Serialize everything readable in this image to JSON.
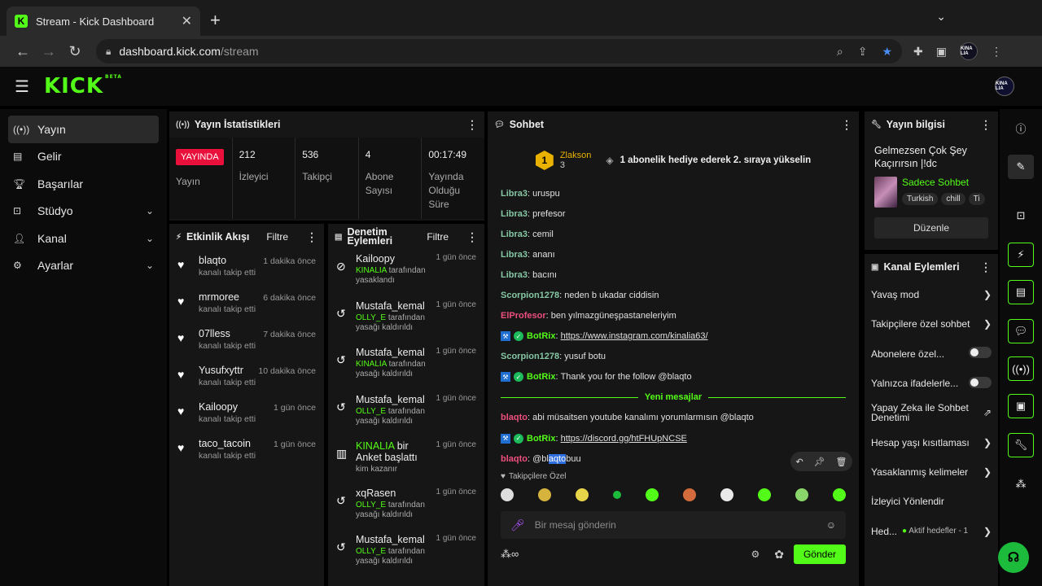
{
  "browser": {
    "tab_title": "Stream - Kick Dashboard",
    "tab_favicon": "K",
    "url_host": "dashboard.kick.com",
    "url_path": "/stream",
    "profile_badge": "KINA LIA"
  },
  "app": {
    "logo": "KICK",
    "logo_tag": "BETA",
    "avatar": "KINA LIA"
  },
  "sidebar": {
    "items": [
      {
        "label": "Yayın",
        "icon": "broadcast-icon"
      },
      {
        "label": "Gelir",
        "icon": "revenue-icon"
      },
      {
        "label": "Başarılar",
        "icon": "trophy-icon"
      },
      {
        "label": "Stüdyo",
        "icon": "studio-icon"
      },
      {
        "label": "Kanal",
        "icon": "channel-icon"
      },
      {
        "label": "Ayarlar",
        "icon": "gear-icon"
      }
    ]
  },
  "stats_panel": {
    "title": "Yayın İstatistikleri",
    "live_badge": "YAYINDA",
    "live_label": "Yayın",
    "viewers_value": "212",
    "viewers_label": "İzleyici",
    "followers_value": "536",
    "followers_label": "Takipçi",
    "subs_value": "4",
    "subs_label": "Abone Sayısı",
    "duration_value": "00:17:49",
    "duration_label": "Yayında Olduğu Süre"
  },
  "activity_panel": {
    "title": "Etkinlik Akışı",
    "filter": "Filtre",
    "rows": [
      {
        "name": "blaqto",
        "sub": "kanalı takip etti",
        "time": "1 dakika önce"
      },
      {
        "name": "mrmoree",
        "sub": "kanalı takip etti",
        "time": "6 dakika önce"
      },
      {
        "name": "07lless",
        "sub": "kanalı takip etti",
        "time": "7 dakika önce"
      },
      {
        "name": "Yusufxyttr",
        "sub": "kanalı takip etti",
        "time": "10 dakika önce"
      },
      {
        "name": "Kailoopy",
        "sub": "kanalı takip etti",
        "time": "1 gün önce"
      },
      {
        "name": "taco_tacoin",
        "sub": "kanalı takip etti",
        "time": "1 gün önce"
      }
    ]
  },
  "moderation_panel": {
    "title": "Denetim Eylemleri",
    "filter": "Filtre",
    "rows": [
      {
        "name": "Kailoopy",
        "by": "KINALIA",
        "sub": "tarafından yasaklandı",
        "time": "1 gün önce"
      },
      {
        "name": "Mustafa_kemal",
        "by": "OLLY_E",
        "sub": "tarafından yasağı kaldırıldı",
        "time": "1 gün önce"
      },
      {
        "name": "Mustafa_kemal",
        "by": "KINALIA",
        "sub": "tarafından yasağı kaldırıldı",
        "time": "1 gün önce"
      },
      {
        "name": "Mustafa_kemal",
        "by": "OLLY_E",
        "sub": "tarafından yasağı kaldırıldı",
        "time": "1 gün önce"
      },
      {
        "name": "bir Anket başlattı",
        "by": "KINALIA",
        "sub": "kim kazanır",
        "time": "1 gün önce"
      },
      {
        "name": "xqRasen",
        "by": "OLLY_E",
        "sub": "tarafından yasağı kaldırıldı",
        "time": "1 gün önce"
      },
      {
        "name": "Mustafa_kemal",
        "by": "OLLY_E",
        "sub": "tarafından yasağı kaldırıldı",
        "time": "1 gün önce"
      }
    ]
  },
  "chat": {
    "title": "Sohbet",
    "pinned_rank": "1",
    "pinned_name": "Zlakson",
    "pinned_count": "3",
    "pinned_message": "1 abonelik hediye ederek 2. sıraya yükselin",
    "messages": [
      {
        "user": "Libra3",
        "text": "uruspu",
        "color": "g"
      },
      {
        "user": "Libra3",
        "text": "prefesor",
        "color": "g"
      },
      {
        "user": "Libra3",
        "text": "cemil",
        "color": "g"
      },
      {
        "user": "Libra3",
        "text": "ananı",
        "color": "g"
      },
      {
        "user": "Libra3",
        "text": "bacını",
        "color": "g"
      },
      {
        "user": "Scorpion1278",
        "text": "neden b ukadar ciddisin",
        "color": "g"
      },
      {
        "user": "ElProfesor",
        "text": "ben yılmazgüneşpastaneleriyim",
        "color": "r"
      },
      {
        "user": "BotRix",
        "text": "https://www.instagram.com/kinalia63/",
        "color": "lg",
        "bot": true,
        "link": true
      },
      {
        "user": "Scorpion1278",
        "text": "yusuf botu",
        "color": "g"
      },
      {
        "user": "BotRix",
        "text": "Thank you for the follow @blaqto",
        "color": "lg",
        "bot": true
      }
    ],
    "new_messages_label": "Yeni mesajlar",
    "new_messages": [
      {
        "user": "blaqto",
        "text": "abi müsaitsen youtube kanalımı yorumlarmısın @blaqto",
        "color": "r"
      },
      {
        "user": "BotRix",
        "text": "https://discord.gg/htFHUpNCSE",
        "color": "lg",
        "bot": true,
        "link": true
      }
    ],
    "last_user": "blaqto",
    "last_pre": "@bl",
    "last_sel": "aqto",
    "last_post": " buu",
    "follow_only": "Takipçilere Özel",
    "input_placeholder": "Bir mesaj gönderin",
    "send_label": "Gönder"
  },
  "stream_info": {
    "title": "Yayın bilgisi",
    "stream_title": "Gelmezsen Çok Şey Kaçırırsın |!dc",
    "category": "Sadece Sohbet",
    "tags": [
      "Turkish",
      "chill",
      "Ti"
    ],
    "edit_label": "Düzenle"
  },
  "channel_actions": {
    "title": "Kanal Eylemleri",
    "rows": [
      {
        "label": "Yavaş mod",
        "ctrl": "arrow"
      },
      {
        "label": "Takipçilere özel sohbet",
        "ctrl": "arrow"
      },
      {
        "label": "Abonelere özel...",
        "ctrl": "toggle"
      },
      {
        "label": "Yalnızca ifadelerle...",
        "ctrl": "toggle"
      },
      {
        "label": "Yapay Zeka ile Sohbet Denetimi",
        "ctrl": "ext"
      },
      {
        "label": "Hesap yaşı kısıtlaması",
        "ctrl": "arrow"
      },
      {
        "label": "Yasaklanmış kelimeler",
        "ctrl": "arrow"
      },
      {
        "label": "İzleyici Yönlendir",
        "ctrl": "none"
      },
      {
        "label": "Hed...",
        "ctrl": "goals"
      }
    ],
    "goals_text": "Aktif hedefler - 1"
  },
  "colors": {
    "brand": "#53fc18",
    "live": "#e9113c",
    "panel": "#161616"
  }
}
